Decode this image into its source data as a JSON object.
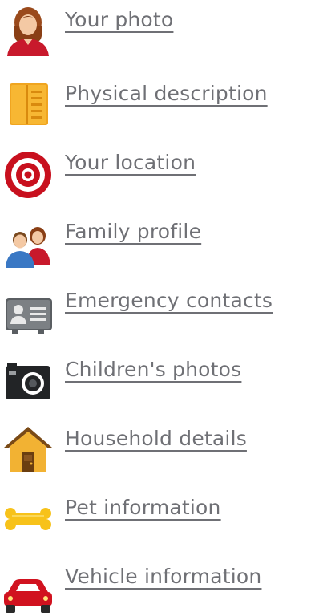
{
  "menu": {
    "items": [
      {
        "label": "Your photo",
        "icon": "woman-avatar-icon"
      },
      {
        "label": "Physical description",
        "icon": "notepad-icon"
      },
      {
        "label": "Your location",
        "icon": "target-icon"
      },
      {
        "label": "Family profile",
        "icon": "family-icon"
      },
      {
        "label": "Emergency contacts",
        "icon": "contact-card-icon"
      },
      {
        "label": "Children's photos",
        "icon": "camera-icon"
      },
      {
        "label": "Household details",
        "icon": "house-icon"
      },
      {
        "label": "Pet information",
        "icon": "bone-icon"
      },
      {
        "label": "Vehicle information",
        "icon": "car-icon"
      }
    ]
  },
  "colors": {
    "link_text": "#6f7075",
    "background": "#ffffff"
  }
}
